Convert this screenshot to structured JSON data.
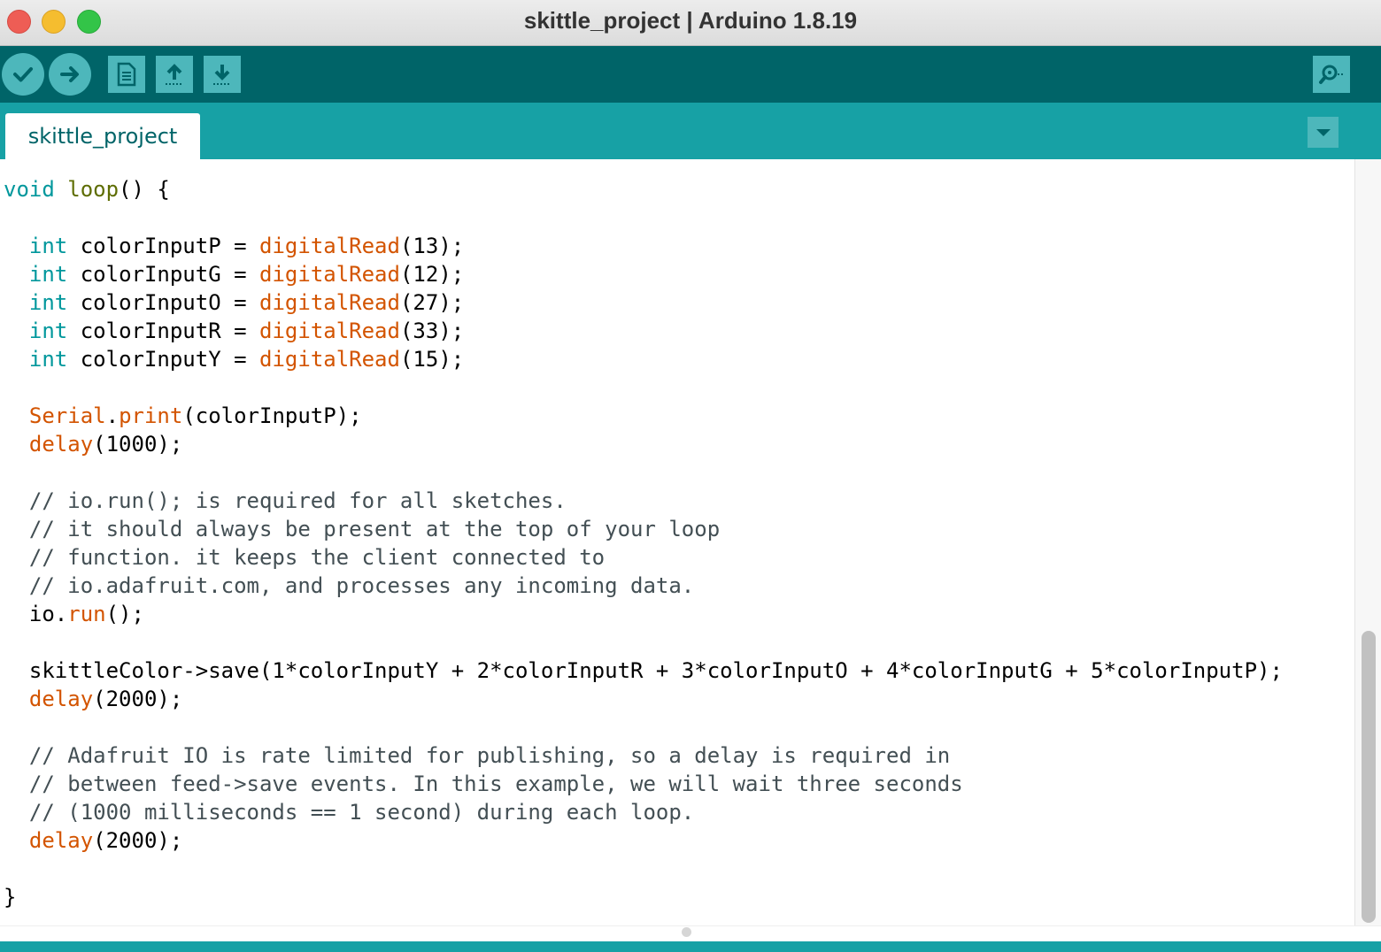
{
  "window": {
    "title": "skittle_project | Arduino 1.8.19"
  },
  "toolbar": {
    "buttons": [
      {
        "name": "verify",
        "icon": "checkmark-icon"
      },
      {
        "name": "upload",
        "icon": "arrow-right-icon"
      },
      {
        "name": "new",
        "icon": "new-document-icon"
      },
      {
        "name": "open",
        "icon": "arrow-up-icon"
      },
      {
        "name": "save",
        "icon": "arrow-down-icon"
      }
    ],
    "serial_monitor_icon": "magnifier-icon"
  },
  "tabs": [
    {
      "label": "skittle_project",
      "active": true
    }
  ],
  "tab_menu_icon": "triangle-down-icon",
  "colors": {
    "titlebar": "#dcdcdc",
    "toolbar": "#006468",
    "tabstrip": "#17a1a5",
    "button": "#4db7bb",
    "keyword_type": "#00979c",
    "keyword_function": "#d35400",
    "function_name": "#5e6d03",
    "comment": "#434f54"
  },
  "code": {
    "lines": [
      [
        {
          "t": "void",
          "c": "type"
        },
        {
          "t": " ",
          "c": "plain"
        },
        {
          "t": "loop",
          "c": "loop"
        },
        {
          "t": "() {",
          "c": "plain"
        }
      ],
      [],
      [
        {
          "t": "  ",
          "c": "plain"
        },
        {
          "t": "int",
          "c": "type"
        },
        {
          "t": " colorInputP = ",
          "c": "plain"
        },
        {
          "t": "digitalRead",
          "c": "func"
        },
        {
          "t": "(13);",
          "c": "plain"
        }
      ],
      [
        {
          "t": "  ",
          "c": "plain"
        },
        {
          "t": "int",
          "c": "type"
        },
        {
          "t": " colorInputG = ",
          "c": "plain"
        },
        {
          "t": "digitalRead",
          "c": "func"
        },
        {
          "t": "(12);",
          "c": "plain"
        }
      ],
      [
        {
          "t": "  ",
          "c": "plain"
        },
        {
          "t": "int",
          "c": "type"
        },
        {
          "t": " colorInputO = ",
          "c": "plain"
        },
        {
          "t": "digitalRead",
          "c": "func"
        },
        {
          "t": "(27);",
          "c": "plain"
        }
      ],
      [
        {
          "t": "  ",
          "c": "plain"
        },
        {
          "t": "int",
          "c": "type"
        },
        {
          "t": " colorInputR = ",
          "c": "plain"
        },
        {
          "t": "digitalRead",
          "c": "func"
        },
        {
          "t": "(33);",
          "c": "plain"
        }
      ],
      [
        {
          "t": "  ",
          "c": "plain"
        },
        {
          "t": "int",
          "c": "type"
        },
        {
          "t": " colorInputY = ",
          "c": "plain"
        },
        {
          "t": "digitalRead",
          "c": "func"
        },
        {
          "t": "(15);",
          "c": "plain"
        }
      ],
      [],
      [
        {
          "t": "  ",
          "c": "plain"
        },
        {
          "t": "Serial",
          "c": "func"
        },
        {
          "t": ".",
          "c": "plain"
        },
        {
          "t": "print",
          "c": "func"
        },
        {
          "t": "(colorInputP);",
          "c": "plain"
        }
      ],
      [
        {
          "t": "  ",
          "c": "plain"
        },
        {
          "t": "delay",
          "c": "func"
        },
        {
          "t": "(1000);",
          "c": "plain"
        }
      ],
      [],
      [
        {
          "t": "  // io.run(); is required for all sketches.",
          "c": "comment"
        }
      ],
      [
        {
          "t": "  // it should always be present at the top of your loop",
          "c": "comment"
        }
      ],
      [
        {
          "t": "  // function. it keeps the client connected to",
          "c": "comment"
        }
      ],
      [
        {
          "t": "  // io.adafruit.com, and processes any incoming data.",
          "c": "comment"
        }
      ],
      [
        {
          "t": "  io.",
          "c": "plain"
        },
        {
          "t": "run",
          "c": "func"
        },
        {
          "t": "();",
          "c": "plain"
        }
      ],
      [],
      [
        {
          "t": "  skittleColor->save(1*colorInputY + 2*colorInputR + 3*colorInputO + 4*colorInputG + 5*colorInputP);",
          "c": "plain"
        }
      ],
      [
        {
          "t": "  ",
          "c": "plain"
        },
        {
          "t": "delay",
          "c": "func"
        },
        {
          "t": "(2000);",
          "c": "plain"
        }
      ],
      [],
      [
        {
          "t": "  // Adafruit IO is rate limited for publishing, so a delay is required in",
          "c": "comment"
        }
      ],
      [
        {
          "t": "  // between feed->save events. In this example, we will wait three seconds",
          "c": "comment"
        }
      ],
      [
        {
          "t": "  // (1000 milliseconds == 1 second) during each loop.",
          "c": "comment"
        }
      ],
      [
        {
          "t": "  ",
          "c": "plain"
        },
        {
          "t": "delay",
          "c": "func"
        },
        {
          "t": "(2000);",
          "c": "plain"
        }
      ],
      [],
      [
        {
          "t": "}",
          "c": "plain"
        }
      ]
    ]
  }
}
